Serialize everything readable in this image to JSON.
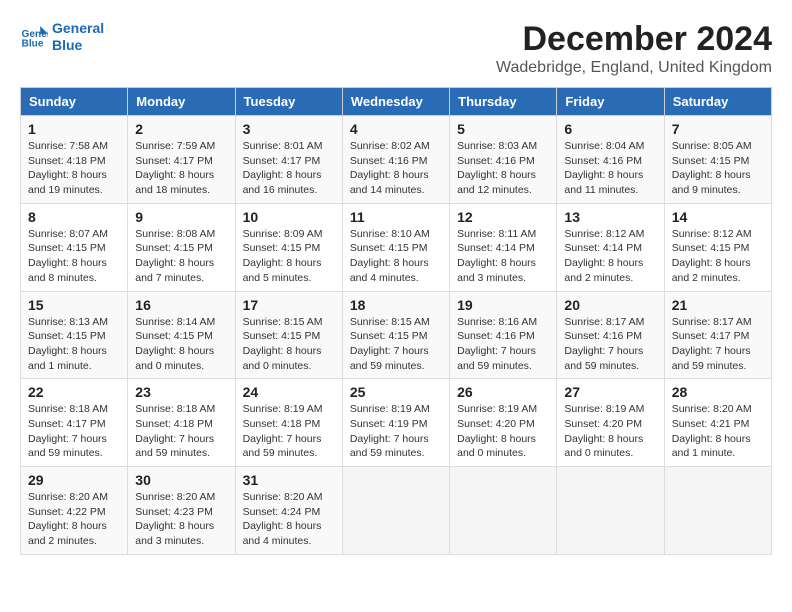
{
  "logo": {
    "line1": "General",
    "line2": "Blue"
  },
  "title": "December 2024",
  "subtitle": "Wadebridge, England, United Kingdom",
  "days_of_week": [
    "Sunday",
    "Monday",
    "Tuesday",
    "Wednesday",
    "Thursday",
    "Friday",
    "Saturday"
  ],
  "weeks": [
    [
      {
        "day": "1",
        "sunrise": "7:58 AM",
        "sunset": "4:18 PM",
        "daylight": "8 hours and 19 minutes."
      },
      {
        "day": "2",
        "sunrise": "7:59 AM",
        "sunset": "4:17 PM",
        "daylight": "8 hours and 18 minutes."
      },
      {
        "day": "3",
        "sunrise": "8:01 AM",
        "sunset": "4:17 PM",
        "daylight": "8 hours and 16 minutes."
      },
      {
        "day": "4",
        "sunrise": "8:02 AM",
        "sunset": "4:16 PM",
        "daylight": "8 hours and 14 minutes."
      },
      {
        "day": "5",
        "sunrise": "8:03 AM",
        "sunset": "4:16 PM",
        "daylight": "8 hours and 12 minutes."
      },
      {
        "day": "6",
        "sunrise": "8:04 AM",
        "sunset": "4:16 PM",
        "daylight": "8 hours and 11 minutes."
      },
      {
        "day": "7",
        "sunrise": "8:05 AM",
        "sunset": "4:15 PM",
        "daylight": "8 hours and 9 minutes."
      }
    ],
    [
      {
        "day": "8",
        "sunrise": "8:07 AM",
        "sunset": "4:15 PM",
        "daylight": "8 hours and 8 minutes."
      },
      {
        "day": "9",
        "sunrise": "8:08 AM",
        "sunset": "4:15 PM",
        "daylight": "8 hours and 7 minutes."
      },
      {
        "day": "10",
        "sunrise": "8:09 AM",
        "sunset": "4:15 PM",
        "daylight": "8 hours and 5 minutes."
      },
      {
        "day": "11",
        "sunrise": "8:10 AM",
        "sunset": "4:15 PM",
        "daylight": "8 hours and 4 minutes."
      },
      {
        "day": "12",
        "sunrise": "8:11 AM",
        "sunset": "4:14 PM",
        "daylight": "8 hours and 3 minutes."
      },
      {
        "day": "13",
        "sunrise": "8:12 AM",
        "sunset": "4:14 PM",
        "daylight": "8 hours and 2 minutes."
      },
      {
        "day": "14",
        "sunrise": "8:12 AM",
        "sunset": "4:15 PM",
        "daylight": "8 hours and 2 minutes."
      }
    ],
    [
      {
        "day": "15",
        "sunrise": "8:13 AM",
        "sunset": "4:15 PM",
        "daylight": "8 hours and 1 minute."
      },
      {
        "day": "16",
        "sunrise": "8:14 AM",
        "sunset": "4:15 PM",
        "daylight": "8 hours and 0 minutes."
      },
      {
        "day": "17",
        "sunrise": "8:15 AM",
        "sunset": "4:15 PM",
        "daylight": "8 hours and 0 minutes."
      },
      {
        "day": "18",
        "sunrise": "8:15 AM",
        "sunset": "4:15 PM",
        "daylight": "7 hours and 59 minutes."
      },
      {
        "day": "19",
        "sunrise": "8:16 AM",
        "sunset": "4:16 PM",
        "daylight": "7 hours and 59 minutes."
      },
      {
        "day": "20",
        "sunrise": "8:17 AM",
        "sunset": "4:16 PM",
        "daylight": "7 hours and 59 minutes."
      },
      {
        "day": "21",
        "sunrise": "8:17 AM",
        "sunset": "4:17 PM",
        "daylight": "7 hours and 59 minutes."
      }
    ],
    [
      {
        "day": "22",
        "sunrise": "8:18 AM",
        "sunset": "4:17 PM",
        "daylight": "7 hours and 59 minutes."
      },
      {
        "day": "23",
        "sunrise": "8:18 AM",
        "sunset": "4:18 PM",
        "daylight": "7 hours and 59 minutes."
      },
      {
        "day": "24",
        "sunrise": "8:19 AM",
        "sunset": "4:18 PM",
        "daylight": "7 hours and 59 minutes."
      },
      {
        "day": "25",
        "sunrise": "8:19 AM",
        "sunset": "4:19 PM",
        "daylight": "7 hours and 59 minutes."
      },
      {
        "day": "26",
        "sunrise": "8:19 AM",
        "sunset": "4:20 PM",
        "daylight": "8 hours and 0 minutes."
      },
      {
        "day": "27",
        "sunrise": "8:19 AM",
        "sunset": "4:20 PM",
        "daylight": "8 hours and 0 minutes."
      },
      {
        "day": "28",
        "sunrise": "8:20 AM",
        "sunset": "4:21 PM",
        "daylight": "8 hours and 1 minute."
      }
    ],
    [
      {
        "day": "29",
        "sunrise": "8:20 AM",
        "sunset": "4:22 PM",
        "daylight": "8 hours and 2 minutes."
      },
      {
        "day": "30",
        "sunrise": "8:20 AM",
        "sunset": "4:23 PM",
        "daylight": "8 hours and 3 minutes."
      },
      {
        "day": "31",
        "sunrise": "8:20 AM",
        "sunset": "4:24 PM",
        "daylight": "8 hours and 4 minutes."
      },
      null,
      null,
      null,
      null
    ]
  ]
}
